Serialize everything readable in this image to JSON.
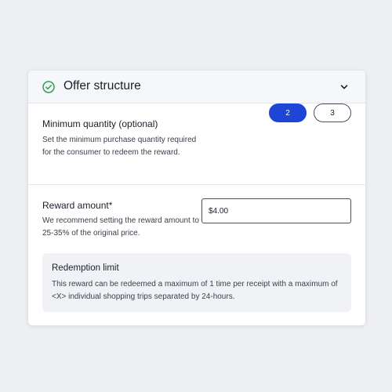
{
  "header": {
    "title": "Offer structure",
    "status_icon": "check-circle-icon",
    "toggle_icon": "chevron-down-icon"
  },
  "minimum_quantity": {
    "title": "Minimum quantity (optional)",
    "description": "Set the minimum purchase quantity required for the consumer to redeem the reward.",
    "options": [
      "2",
      "3"
    ],
    "selected": "2"
  },
  "reward_amount": {
    "title": "Reward amount*",
    "description": "We recommend setting the reward amount to 25-35% of the original price.",
    "value": "$4.00"
  },
  "redemption_limit": {
    "title": "Redemption limit",
    "text": "This reward can be redeemed a maximum of 1 time per receipt with a maximum of <X> individual shopping trips separated by 24-hours."
  },
  "colors": {
    "accent": "#1f45d6",
    "success": "#2e9e5b",
    "background": "#eeeff3"
  }
}
